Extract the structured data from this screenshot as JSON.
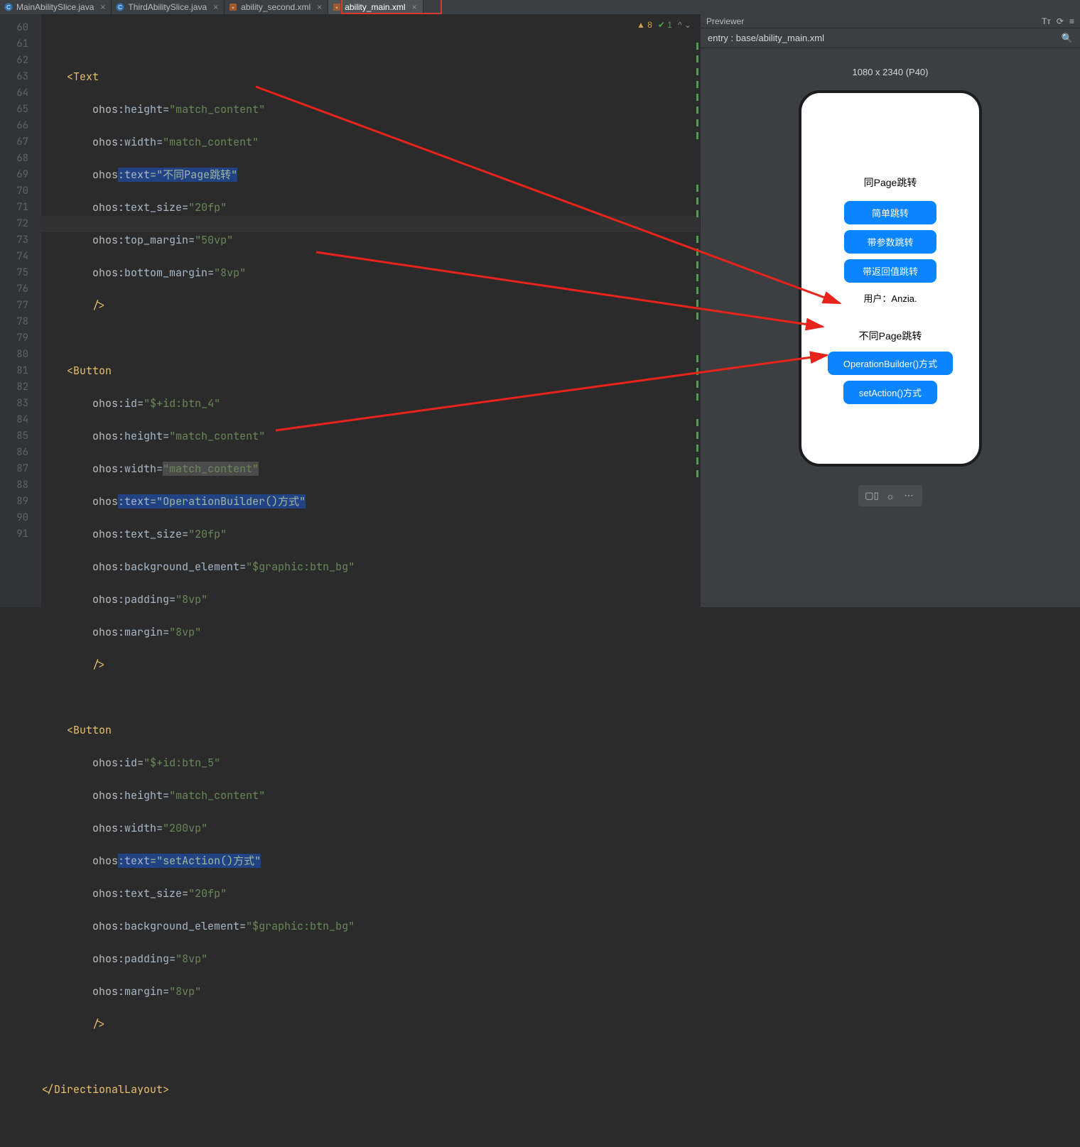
{
  "tabs": {
    "t0": "MainAbilitySlice.java",
    "t1": "ThirdAbilitySlice.java",
    "t2": "ability_second.xml",
    "t3": "ability_main.xml"
  },
  "inspection": {
    "warn": "▲ 8",
    "ok": "✔ 1",
    "caret": "^ ⌄"
  },
  "lines": {
    "l60": "60",
    "l61": "61",
    "l62": "62",
    "l63": "63",
    "l64": "64",
    "l65": "65",
    "l66": "66",
    "l67": "67",
    "l68": "68",
    "l69": "69",
    "l70": "70",
    "l71": "71",
    "l72": "72",
    "l73": "73",
    "l74": "74",
    "l75": "75",
    "l76": "76",
    "l77": "77",
    "l78": "78",
    "l79": "79",
    "l80": "80",
    "l81": "81",
    "l82": "82",
    "l83": "83",
    "l84": "84",
    "l85": "85",
    "l86": "86",
    "l87": "87",
    "l88": "88",
    "l89": "89",
    "l90": "90",
    "l91": "91"
  },
  "code": {
    "seg": {
      "text_open": "<Text",
      "button_open": "<Button",
      "slash_close": "/>",
      "dir_close": "</DirectionalLayout>",
      "ohos": "ohos",
      "col": ":",
      "eq": "=",
      "attr_height": "height",
      "attr_width": "width",
      "attr_text": "text",
      "attr_text_size": "text_size",
      "attr_top_margin": "top_margin",
      "attr_bottom_margin": "bottom_margin",
      "attr_id": "id",
      "attr_bg": "background_element",
      "attr_padding": "padding",
      "attr_margin": "margin",
      "v_match_content": "\"match_content\"",
      "v_200vp": "\"200vp\"",
      "v_20fp": "\"20fp\"",
      "v_50vp": "\"50vp\"",
      "v_8vp": "\"8vp\"",
      "v_btn4": "\"$+id:btn_4\"",
      "v_btn5": "\"$+id:btn_5\"",
      "v_bg": "\"$graphic:btn_bg\"",
      "v_txt_diffpage": "\"不同Page跳转\"",
      "v_txt_opbuilder": "\"OperationBuilder()方式\"",
      "v_txt_setaction": "\"setAction()方式\""
    }
  },
  "preview": {
    "panelTitle": "Previewer",
    "entry": "entry : base/ability_main.xml",
    "deviceCaption": "1080 x 2340 (P40)",
    "phone": {
      "title1": "同Page跳转",
      "btn1": "简单跳转",
      "btn2": "带参数跳转",
      "btn3": "带返回值跳转",
      "userLabel": "用户：Anzia.",
      "title2": "不同Page跳转",
      "btn4": "OperationBuilder()方式",
      "btn5": "setAction()方式"
    }
  }
}
